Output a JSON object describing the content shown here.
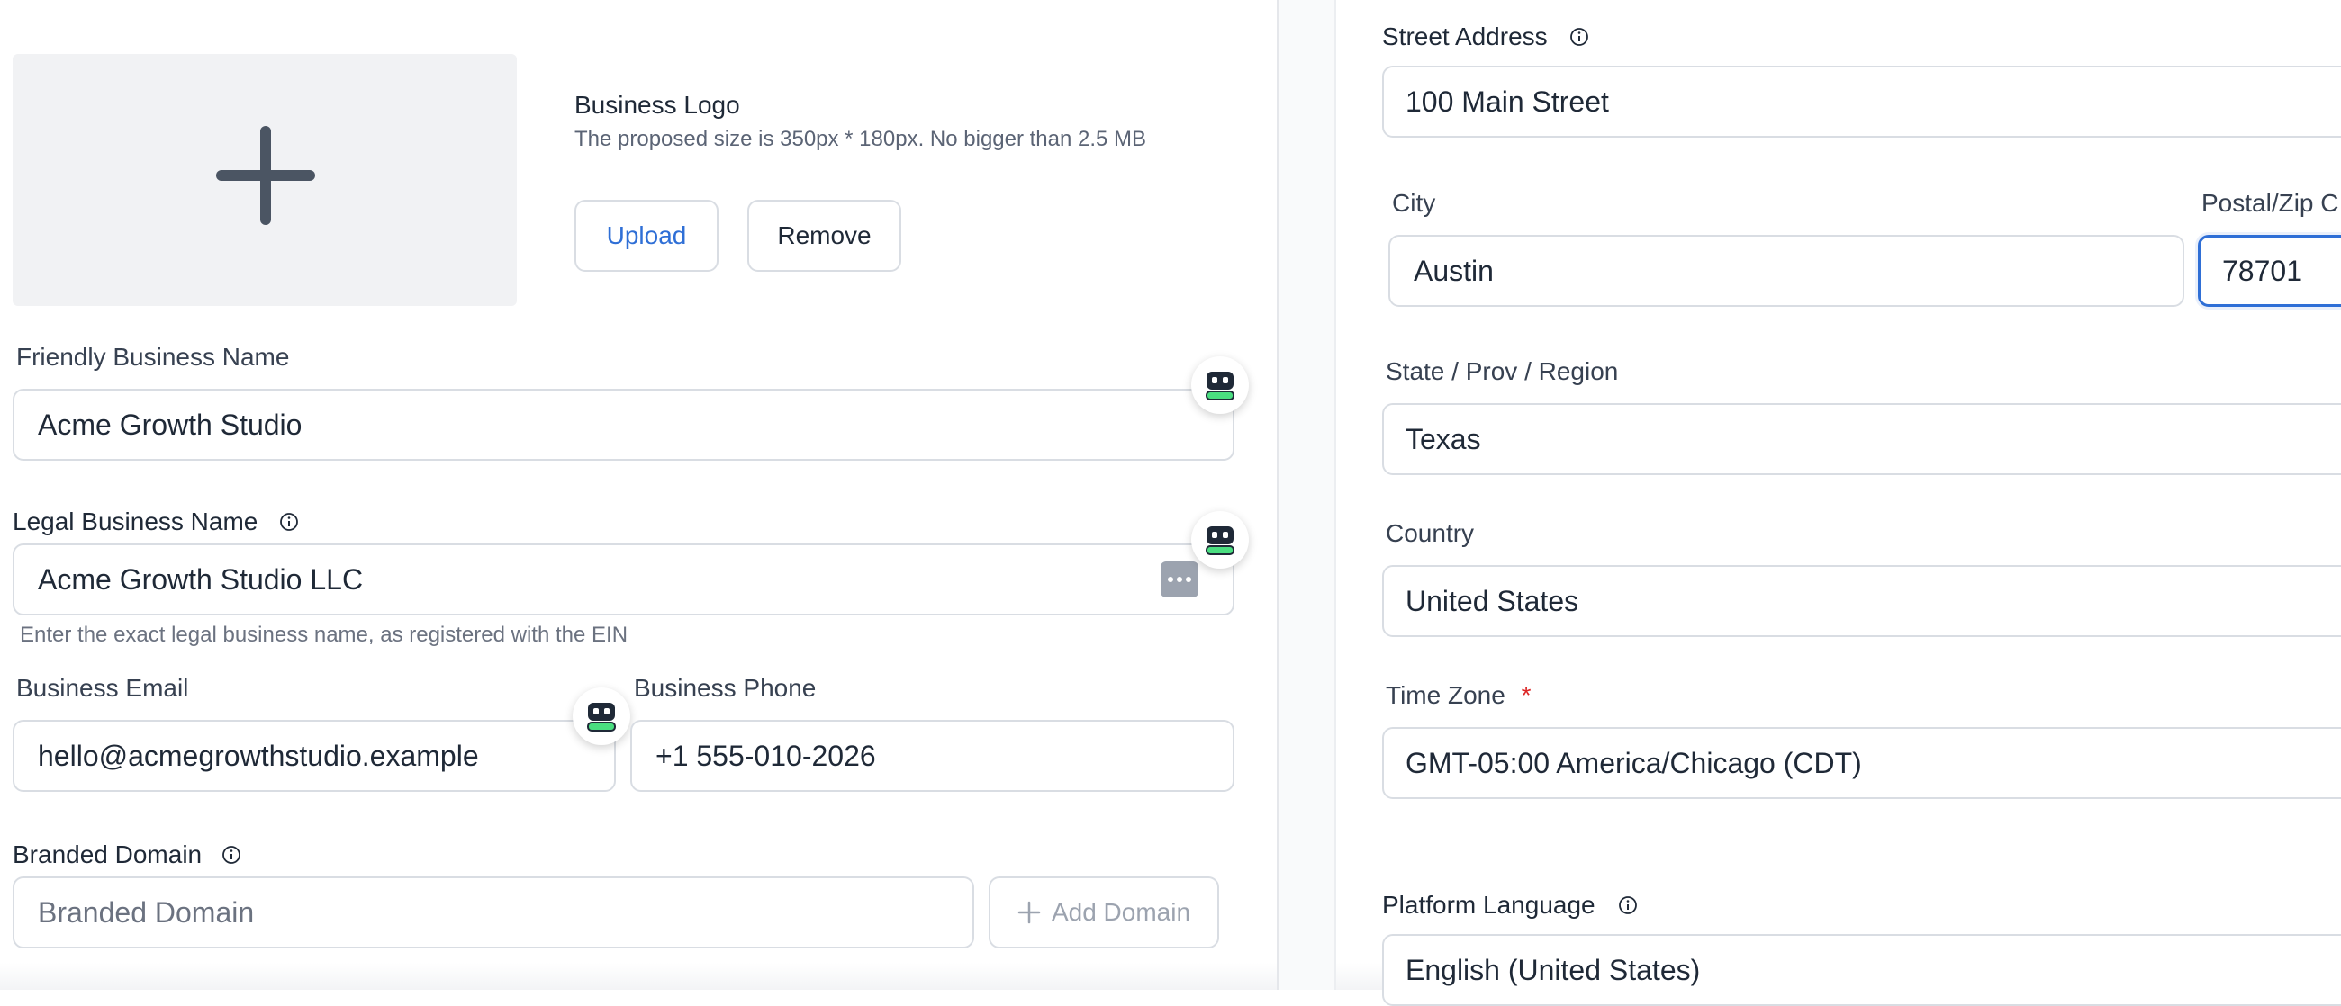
{
  "logo": {
    "title": "Business Logo",
    "hint": "The proposed size is 350px * 180px. No bigger than 2.5 MB",
    "upload_label": "Upload",
    "remove_label": "Remove"
  },
  "friendly_name": {
    "label": "Friendly Business Name",
    "value": "Acme Growth Studio"
  },
  "legal_name": {
    "label": "Legal Business Name",
    "value": "Acme Growth Studio LLC",
    "helper": "Enter the exact legal business name, as registered with the EIN"
  },
  "email": {
    "label": "Business Email",
    "value": "hello@acmegrowthstudio.example"
  },
  "phone": {
    "label": "Business Phone",
    "value": "+1 555-010-2026"
  },
  "domain": {
    "label": "Branded Domain",
    "placeholder": "Branded Domain",
    "add_label": "Add Domain"
  },
  "street": {
    "label": "Street Address",
    "value": "100 Main Street"
  },
  "city": {
    "label": "City",
    "value": "Austin"
  },
  "postal": {
    "label": "Postal/Zip C",
    "value": "78701"
  },
  "state": {
    "label": "State / Prov / Region",
    "value": "Texas"
  },
  "country": {
    "label": "Country",
    "value": "United States"
  },
  "timezone": {
    "label": "Time Zone",
    "required_mark": "*",
    "value": "GMT-05:00 America/Chicago (CDT)"
  },
  "language": {
    "label": "Platform Language",
    "value": "English (United States)"
  },
  "colors": {
    "accent": "#2f6fd6",
    "required": "#dc2626",
    "bot_green": "#4ade80"
  },
  "icons": [
    "plus-icon",
    "info-icon",
    "assistant-bot-icon",
    "more-dots-icon"
  ]
}
